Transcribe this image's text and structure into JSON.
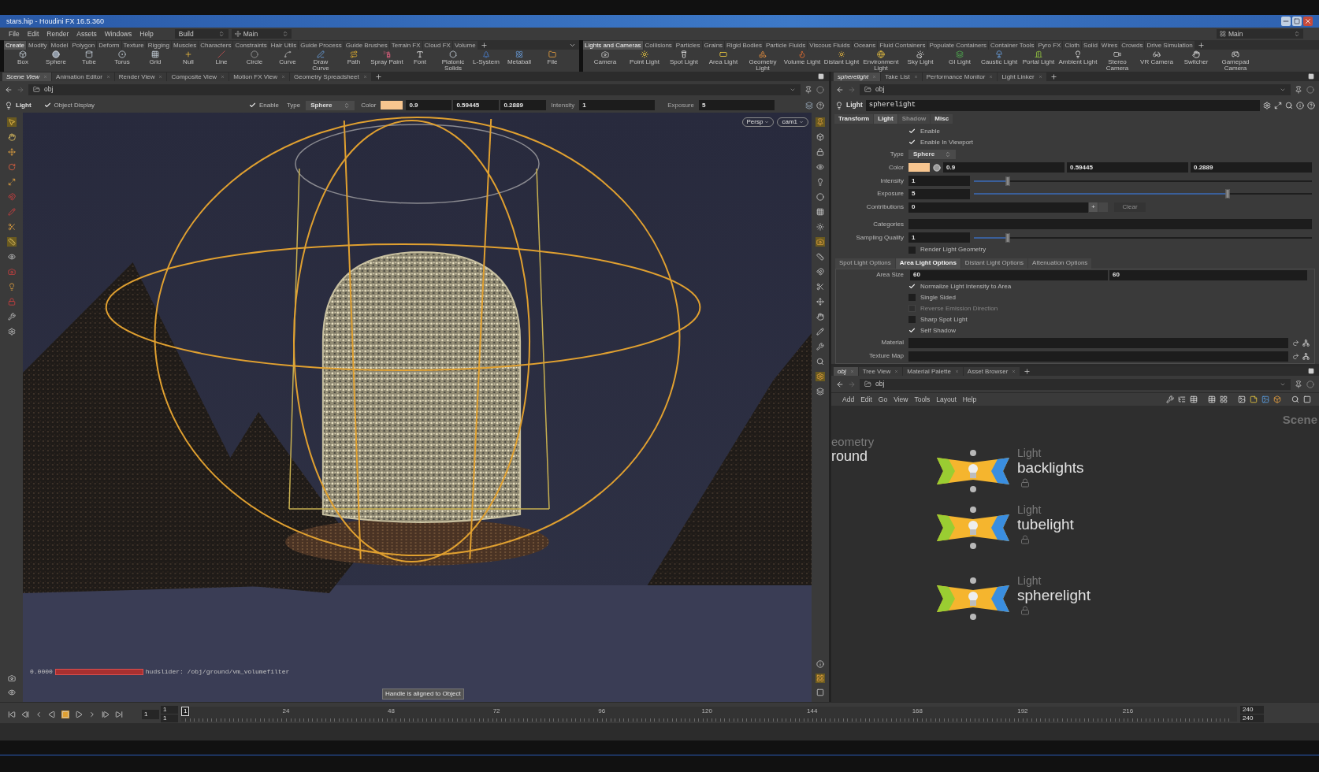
{
  "window": {
    "title": "stars.hip - Houdini FX 16.5.360"
  },
  "menu_bar": {
    "items": [
      "File",
      "Edit",
      "Render",
      "Assets",
      "Windows",
      "Help"
    ],
    "desktop": "Build",
    "layout": "Main",
    "right_layout": "Main"
  },
  "shelves": [
    {
      "tabs": [
        {
          "label": "Create",
          "selected": true
        },
        {
          "label": "Modify",
          "selected": false
        },
        {
          "label": "Model",
          "selected": false
        },
        {
          "label": "Polygon",
          "selected": false
        },
        {
          "label": "Deform",
          "selected": false
        },
        {
          "label": "Texture",
          "selected": false
        },
        {
          "label": "Rigging",
          "selected": false
        },
        {
          "label": "Muscles",
          "selected": false
        },
        {
          "label": "Characters",
          "selected": false
        },
        {
          "label": "Constraints",
          "selected": false
        },
        {
          "label": "Hair Utils",
          "selected": false
        },
        {
          "label": "Guide Process",
          "selected": false
        },
        {
          "label": "Guide Brushes",
          "selected": false
        },
        {
          "label": "Terrain FX",
          "selected": false
        },
        {
          "label": "Cloud FX",
          "selected": false
        },
        {
          "label": "Volume",
          "selected": false
        }
      ],
      "tools": [
        "Box",
        "Sphere",
        "Tube",
        "Torus",
        "Grid",
        "Null",
        "Line",
        "Circle",
        "Curve",
        "Draw Curve",
        "Path",
        "Spray Paint",
        "Font",
        "Platonic Solids",
        "L-System",
        "Metaball",
        "File"
      ]
    },
    {
      "tabs": [
        {
          "label": "Lights and Cameras",
          "selected": true
        },
        {
          "label": "Collisions",
          "selected": false
        },
        {
          "label": "Particles",
          "selected": false
        },
        {
          "label": "Grains",
          "selected": false
        },
        {
          "label": "Rigid Bodies",
          "selected": false
        },
        {
          "label": "Particle Fluids",
          "selected": false
        },
        {
          "label": "Viscous Fluids",
          "selected": false
        },
        {
          "label": "Oceans",
          "selected": false
        },
        {
          "label": "Fluid Containers",
          "selected": false
        },
        {
          "label": "Populate Containers",
          "selected": false
        },
        {
          "label": "Container Tools",
          "selected": false
        },
        {
          "label": "Pyro FX",
          "selected": false
        },
        {
          "label": "Cloth",
          "selected": false
        },
        {
          "label": "Solid",
          "selected": false
        },
        {
          "label": "Wires",
          "selected": false
        },
        {
          "label": "Crowds",
          "selected": false
        },
        {
          "label": "Drive Simulation",
          "selected": false
        }
      ],
      "tools": [
        "Camera",
        "Point Light",
        "Spot Light",
        "Area Light",
        "Geometry Light",
        "Volume Light",
        "Distant Light",
        "Environment Light",
        "Sky Light",
        "GI Light",
        "Caustic Light",
        "Portal Light",
        "Ambient Light",
        "Stereo Camera",
        "VR Camera",
        "Switcher",
        "Gamepad Camera"
      ]
    }
  ],
  "scene_pane": {
    "tabs": [
      {
        "label": "Scene View",
        "selected": true
      },
      {
        "label": "Animation Editor",
        "selected": false
      },
      {
        "label": "Render View",
        "selected": false
      },
      {
        "label": "Composite View",
        "selected": false
      },
      {
        "label": "Motion FX View",
        "selected": false
      },
      {
        "label": "Geometry Spreadsheet",
        "selected": false
      }
    ],
    "path": "obj",
    "toolbar": {
      "node_type": "Light",
      "object_display": {
        "label": "Object Display",
        "checked": true
      },
      "enable": {
        "label": "Enable",
        "checked": true
      },
      "type_label": "Type",
      "type_value": "Sphere",
      "color_label": "Color",
      "color": "#f7c58f",
      "color_values": [
        "0.9",
        "0.59445",
        "0.2889"
      ],
      "intensity_label": "Intensity",
      "intensity": "1",
      "exposure_label": "Exposure",
      "exposure": "5"
    },
    "camera_menus": [
      "Persp",
      "cam1"
    ],
    "hud_slider": {
      "value": "0.0000",
      "label": "hudslider: /obj/ground/vm_volumefilter"
    },
    "tooltip": "Handle is aligned to Object"
  },
  "parameter_pane": {
    "tabs": [
      {
        "label": "spherelight",
        "selected": true
      },
      {
        "label": "Take List",
        "selected": false
      },
      {
        "label": "Performance Monitor",
        "selected": false
      },
      {
        "label": "Light Linker",
        "selected": false
      }
    ],
    "path": "obj",
    "node_type": "Light",
    "node_name": "spherelight",
    "parm_tabs": [
      {
        "label": "Transform",
        "selected": false,
        "disabled": false
      },
      {
        "label": "Light",
        "selected": true,
        "disabled": false
      },
      {
        "label": "Shadow",
        "selected": false,
        "disabled": true
      },
      {
        "label": "Misc",
        "selected": false,
        "disabled": false
      }
    ],
    "params": [
      {
        "kind": "checkbox",
        "label": "Enable",
        "checked": true,
        "disabled": false
      },
      {
        "kind": "checkbox",
        "label": "Enable In Viewport",
        "checked": true,
        "disabled": false
      },
      {
        "kind": "menu",
        "label": "Type",
        "value": "Sphere"
      },
      {
        "kind": "color",
        "label": "Color",
        "color": "#f7c58f",
        "values": [
          "0.9",
          "0.59445",
          "0.2889"
        ]
      },
      {
        "kind": "slider",
        "label": "Intensity",
        "value": "1",
        "level": 0.1
      },
      {
        "kind": "slider",
        "label": "Exposure",
        "value": "5",
        "level": 0.75
      },
      {
        "kind": "contributions",
        "label": "Contributions",
        "value": "0",
        "add": "+",
        "clear": "Clear",
        "clear_disabled": true
      },
      {
        "kind": "string",
        "label": "Categories"
      },
      {
        "kind": "slider",
        "label": "Sampling Quality",
        "value": "1",
        "level": 0.1
      },
      {
        "kind": "checkbox",
        "label": "Render Light Geometry",
        "checked": false,
        "disabled": false
      }
    ],
    "option_tabs": [
      {
        "label": "Spot Light Options",
        "selected": false
      },
      {
        "label": "Area Light Options",
        "selected": true
      },
      {
        "label": "Distant Light Options",
        "selected": false
      },
      {
        "label": "Attenuation Options",
        "selected": false
      }
    ],
    "options": [
      {
        "kind": "pair",
        "label": "Area Size",
        "values": [
          "60",
          "60"
        ]
      },
      {
        "kind": "checkbox",
        "label": "Normalize Light Intensity to Area",
        "checked": true,
        "disabled": false
      },
      {
        "kind": "checkbox",
        "label": "Single Sided",
        "checked": false,
        "disabled": false
      },
      {
        "kind": "checkbox",
        "label": "Reverse Emission Direction",
        "checked": false,
        "disabled": true
      },
      {
        "kind": "checkbox",
        "label": "Sharp Spot Light",
        "checked": false,
        "disabled": false
      },
      {
        "kind": "checkbox",
        "label": "Self Shadow",
        "checked": true,
        "disabled": false
      },
      {
        "kind": "path",
        "label": "Material"
      },
      {
        "kind": "path",
        "label": "Texture Map"
      }
    ]
  },
  "network_pane": {
    "tabs": [
      {
        "label": "obj",
        "selected": true
      },
      {
        "label": "Tree View",
        "selected": false
      },
      {
        "label": "Material Palette",
        "selected": false
      },
      {
        "label": "Asset Browser",
        "selected": false
      }
    ],
    "path": "obj",
    "menu": [
      "Add",
      "Edit",
      "Go",
      "View",
      "Tools",
      "Layout",
      "Help"
    ],
    "context": "Scene",
    "partial_node": {
      "type": "eometry",
      "name": "round"
    },
    "nodes": [
      {
        "type": "Light",
        "name": "backlights"
      },
      {
        "type": "Light",
        "name": "tubelight"
      },
      {
        "type": "Light",
        "name": "spherelight"
      }
    ]
  },
  "timeline": {
    "start": "1",
    "range_start": "1",
    "range_current": "1",
    "current_frame": "1",
    "ticks": [
      "24",
      "48",
      "72",
      "96",
      "120",
      "144",
      "168",
      "192",
      "216"
    ],
    "range_end": "240",
    "end": "240"
  }
}
